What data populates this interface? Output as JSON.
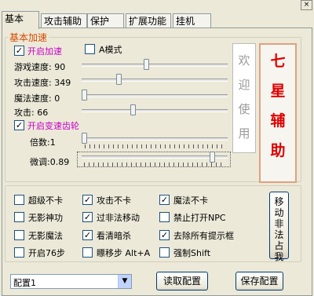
{
  "window": {
    "close_glyph": "×"
  },
  "tabs": [
    {
      "label": "基本"
    },
    {
      "label": "攻击辅助"
    },
    {
      "label": "保护"
    },
    {
      "label": "扩展功能"
    },
    {
      "label": "挂机"
    }
  ],
  "basic": {
    "group_title": "基本加速",
    "enable_speed": {
      "label": "开启加速",
      "checked": true
    },
    "a_mode": {
      "label": "A模式",
      "checked": false
    },
    "sliders": [
      {
        "label": "游戏速度: 90",
        "value": 0.43
      },
      {
        "label": "攻击速度: 349",
        "value": 0.25
      },
      {
        "label": "魔法速度: 0",
        "value": 0.0
      },
      {
        "label": "攻击: 66",
        "value": 0.37
      }
    ],
    "gear": {
      "label": "开启变速齿轮",
      "checked": true
    },
    "multiplier_label": "倍数:1",
    "multiplier_value": 0.0,
    "fine_label": "微调:0.89",
    "fine_value": 0.88,
    "welcome_text": [
      "欢",
      "迎",
      "使",
      "用"
    ],
    "brand_text": [
      "七",
      "星",
      "辅",
      "助"
    ]
  },
  "options": [
    {
      "label": "超级不卡",
      "checked": false
    },
    {
      "label": "攻击不卡",
      "checked": true
    },
    {
      "label": "魔法不卡",
      "checked": true
    },
    {
      "label": "无影神功",
      "checked": false
    },
    {
      "label": "过非法移动",
      "checked": true
    },
    {
      "label": "禁止打开NPC",
      "checked": false
    },
    {
      "label": "无影魔法",
      "checked": false
    },
    {
      "label": "看清暗杀",
      "checked": true
    },
    {
      "label": "去除所有提示框",
      "checked": true
    },
    {
      "label": "开启76步",
      "checked": false
    },
    {
      "label": "瞟移步 Alt+A",
      "checked": false
    },
    {
      "label": "强制Shift",
      "checked": false
    }
  ],
  "move_button_label": [
    "移",
    "动",
    "非",
    "法",
    "占",
    "我"
  ],
  "config": {
    "selected": "配置1",
    "read_label": "读取配置",
    "save_label": "保存配置"
  }
}
